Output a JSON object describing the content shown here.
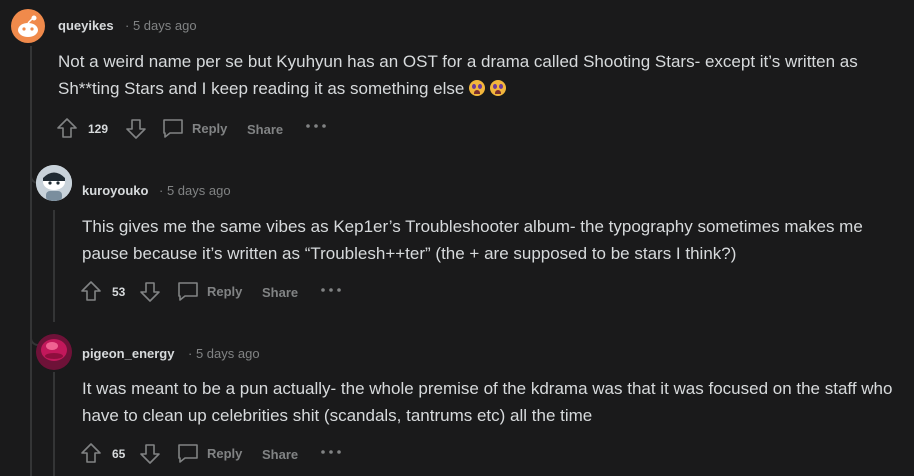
{
  "comments": [
    {
      "author": "queyikes",
      "time": "· 5 days ago",
      "text": "Not a weird name per se but Kyuhyun has an OST for a drama called Shooting Stars- except it’s written as Sh**ting Stars and I keep reading it as something else",
      "emoji_icons": [
        "crying-face-icon",
        "crying-face-icon"
      ],
      "votes": "129",
      "reply_label": "Reply",
      "share_label": "Share"
    },
    {
      "author": "kuroyouko",
      "time": "· 5 days ago",
      "text": "This gives me the same vibes as Kep1er’s Troubleshooter album- the typography sometimes makes me pause because it’s written as “Troublesh++ter” (the + are supposed to be stars I think?)",
      "votes": "53",
      "reply_label": "Reply",
      "share_label": "Share"
    },
    {
      "author": "pigeon_energy",
      "time": "· 5 days ago",
      "text": "It was meant to be a pun actually- the whole premise of the kdrama was that it was focused on the staff who have to clean up celebrities shit (scandals, tantrums etc) all the time",
      "votes": "65",
      "reply_label": "Reply",
      "share_label": "Share"
    }
  ]
}
